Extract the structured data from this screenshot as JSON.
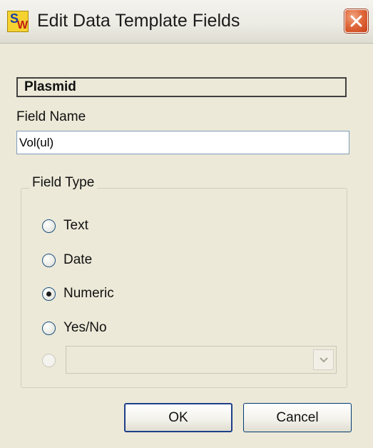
{
  "window": {
    "title": "Edit Data Template Fields",
    "app_icon": "sw-app-icon",
    "close_icon": "close-icon"
  },
  "template_name": "Plasmid",
  "field_name": {
    "label": "Field Name",
    "value": "Vol(ul)"
  },
  "field_type": {
    "label": "Field Type",
    "options": [
      {
        "label": "Text",
        "checked": false
      },
      {
        "label": "Date",
        "checked": false
      },
      {
        "label": "Numeric",
        "checked": true
      },
      {
        "label": "Yes/No",
        "checked": false
      }
    ],
    "custom_option": {
      "selected_value": "",
      "enabled": false
    }
  },
  "buttons": {
    "ok": "OK",
    "cancel": "Cancel"
  },
  "colors": {
    "dialog_bg": "#ECE9D8",
    "close_button": "#E06A3D",
    "input_border": "#7F9DB9"
  }
}
